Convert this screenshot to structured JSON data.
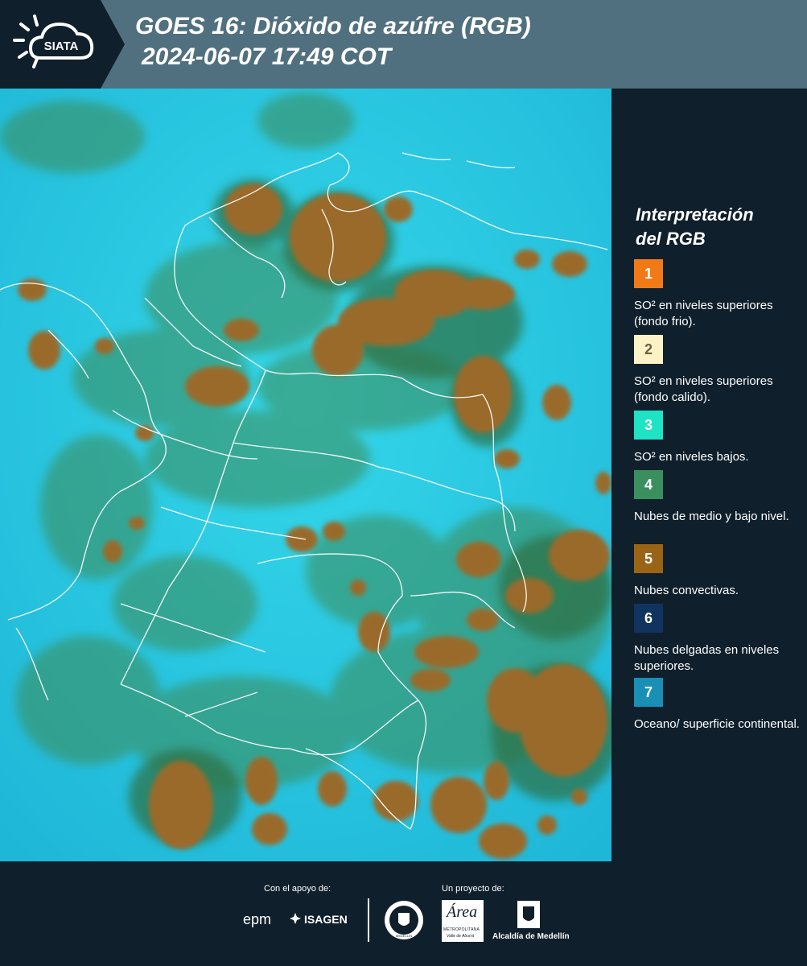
{
  "header": {
    "logo_text": "SIATA",
    "title_line1": "GOES 16: Dióxido de azúfre (RGB)",
    "title_line2": "2024-06-07 17:49 COT"
  },
  "legend": {
    "title_line1": "Interpretación",
    "title_line2": "del RGB",
    "items": [
      {
        "num": "1",
        "text": "SO² en niveles superiores (fondo frio).",
        "color": "#f27a16",
        "text_color": "#ffffff"
      },
      {
        "num": "2",
        "text": "SO² en niveles superiores (fondo calido).",
        "color": "#fbf2c6",
        "text_color": "#6b6040"
      },
      {
        "num": "3",
        "text": "SO² en niveles bajos.",
        "color": "#1ee3c4",
        "text_color": "#ffffff"
      },
      {
        "num": "4",
        "text": "Nubes de medio y bajo nivel.",
        "color": "#3a8f5e",
        "text_color": "#ffffff"
      },
      {
        "num": "5",
        "text": "Nubes convectivas.",
        "color": "#9a6416",
        "text_color": "#ffffff"
      },
      {
        "num": "6",
        "text": "Nubes delgadas en niveles superiores.",
        "color": "#10335f",
        "text_color": "#ffffff"
      },
      {
        "num": "7",
        "text": "Oceano/ superficie continental.",
        "color": "#1a8fb5",
        "text_color": "#ffffff"
      }
    ]
  },
  "footer": {
    "support_label": "Con el apoyo de:",
    "project_label": "Un proyecto de:",
    "epm": "epm",
    "isagen": "ISAGEN",
    "metro_top": "Área",
    "metro_sub": "METROPOLITANA",
    "metro_sub2": "Valle de Aburrá",
    "alcaldia": "Alcaldía de Medellín",
    "seal_text": "MEDELLÍN"
  },
  "colors": {
    "header_bg": "#51707f",
    "page_bg": "#0f1f2c",
    "ocean": "#2ad0e8",
    "cloud": "#9a6a2a",
    "cloud_edge": "#3f7a4a"
  }
}
